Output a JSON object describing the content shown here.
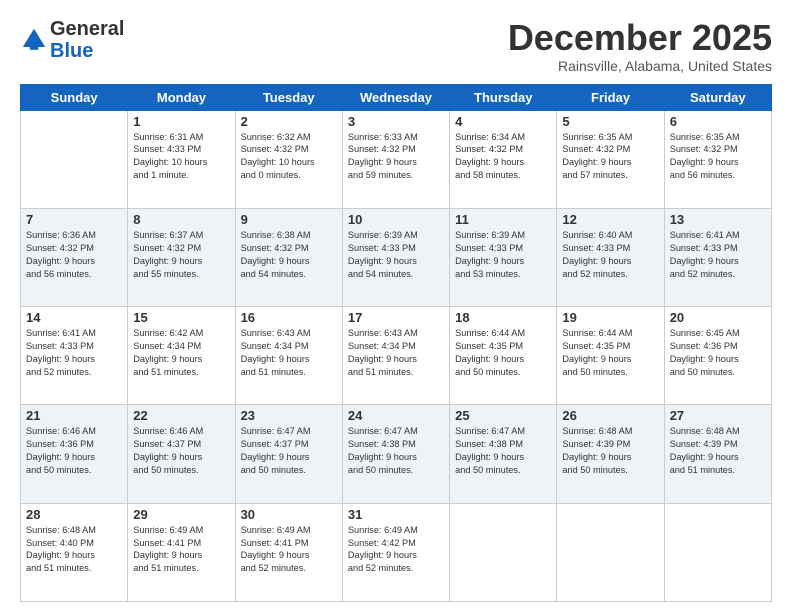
{
  "header": {
    "logo_general": "General",
    "logo_blue": "Blue",
    "month_title": "December 2025",
    "location": "Rainsville, Alabama, United States"
  },
  "days_of_week": [
    "Sunday",
    "Monday",
    "Tuesday",
    "Wednesday",
    "Thursday",
    "Friday",
    "Saturday"
  ],
  "weeks": [
    [
      {
        "day": "",
        "info": ""
      },
      {
        "day": "1",
        "info": "Sunrise: 6:31 AM\nSunset: 4:33 PM\nDaylight: 10 hours\nand 1 minute."
      },
      {
        "day": "2",
        "info": "Sunrise: 6:32 AM\nSunset: 4:32 PM\nDaylight: 10 hours\nand 0 minutes."
      },
      {
        "day": "3",
        "info": "Sunrise: 6:33 AM\nSunset: 4:32 PM\nDaylight: 9 hours\nand 59 minutes."
      },
      {
        "day": "4",
        "info": "Sunrise: 6:34 AM\nSunset: 4:32 PM\nDaylight: 9 hours\nand 58 minutes."
      },
      {
        "day": "5",
        "info": "Sunrise: 6:35 AM\nSunset: 4:32 PM\nDaylight: 9 hours\nand 57 minutes."
      },
      {
        "day": "6",
        "info": "Sunrise: 6:35 AM\nSunset: 4:32 PM\nDaylight: 9 hours\nand 56 minutes."
      }
    ],
    [
      {
        "day": "7",
        "info": "Sunrise: 6:36 AM\nSunset: 4:32 PM\nDaylight: 9 hours\nand 56 minutes."
      },
      {
        "day": "8",
        "info": "Sunrise: 6:37 AM\nSunset: 4:32 PM\nDaylight: 9 hours\nand 55 minutes."
      },
      {
        "day": "9",
        "info": "Sunrise: 6:38 AM\nSunset: 4:32 PM\nDaylight: 9 hours\nand 54 minutes."
      },
      {
        "day": "10",
        "info": "Sunrise: 6:39 AM\nSunset: 4:33 PM\nDaylight: 9 hours\nand 54 minutes."
      },
      {
        "day": "11",
        "info": "Sunrise: 6:39 AM\nSunset: 4:33 PM\nDaylight: 9 hours\nand 53 minutes."
      },
      {
        "day": "12",
        "info": "Sunrise: 6:40 AM\nSunset: 4:33 PM\nDaylight: 9 hours\nand 52 minutes."
      },
      {
        "day": "13",
        "info": "Sunrise: 6:41 AM\nSunset: 4:33 PM\nDaylight: 9 hours\nand 52 minutes."
      }
    ],
    [
      {
        "day": "14",
        "info": "Sunrise: 6:41 AM\nSunset: 4:33 PM\nDaylight: 9 hours\nand 52 minutes."
      },
      {
        "day": "15",
        "info": "Sunrise: 6:42 AM\nSunset: 4:34 PM\nDaylight: 9 hours\nand 51 minutes."
      },
      {
        "day": "16",
        "info": "Sunrise: 6:43 AM\nSunset: 4:34 PM\nDaylight: 9 hours\nand 51 minutes."
      },
      {
        "day": "17",
        "info": "Sunrise: 6:43 AM\nSunset: 4:34 PM\nDaylight: 9 hours\nand 51 minutes."
      },
      {
        "day": "18",
        "info": "Sunrise: 6:44 AM\nSunset: 4:35 PM\nDaylight: 9 hours\nand 50 minutes."
      },
      {
        "day": "19",
        "info": "Sunrise: 6:44 AM\nSunset: 4:35 PM\nDaylight: 9 hours\nand 50 minutes."
      },
      {
        "day": "20",
        "info": "Sunrise: 6:45 AM\nSunset: 4:36 PM\nDaylight: 9 hours\nand 50 minutes."
      }
    ],
    [
      {
        "day": "21",
        "info": "Sunrise: 6:46 AM\nSunset: 4:36 PM\nDaylight: 9 hours\nand 50 minutes."
      },
      {
        "day": "22",
        "info": "Sunrise: 6:46 AM\nSunset: 4:37 PM\nDaylight: 9 hours\nand 50 minutes."
      },
      {
        "day": "23",
        "info": "Sunrise: 6:47 AM\nSunset: 4:37 PM\nDaylight: 9 hours\nand 50 minutes."
      },
      {
        "day": "24",
        "info": "Sunrise: 6:47 AM\nSunset: 4:38 PM\nDaylight: 9 hours\nand 50 minutes."
      },
      {
        "day": "25",
        "info": "Sunrise: 6:47 AM\nSunset: 4:38 PM\nDaylight: 9 hours\nand 50 minutes."
      },
      {
        "day": "26",
        "info": "Sunrise: 6:48 AM\nSunset: 4:39 PM\nDaylight: 9 hours\nand 50 minutes."
      },
      {
        "day": "27",
        "info": "Sunrise: 6:48 AM\nSunset: 4:39 PM\nDaylight: 9 hours\nand 51 minutes."
      }
    ],
    [
      {
        "day": "28",
        "info": "Sunrise: 6:48 AM\nSunset: 4:40 PM\nDaylight: 9 hours\nand 51 minutes."
      },
      {
        "day": "29",
        "info": "Sunrise: 6:49 AM\nSunset: 4:41 PM\nDaylight: 9 hours\nand 51 minutes."
      },
      {
        "day": "30",
        "info": "Sunrise: 6:49 AM\nSunset: 4:41 PM\nDaylight: 9 hours\nand 52 minutes."
      },
      {
        "day": "31",
        "info": "Sunrise: 6:49 AM\nSunset: 4:42 PM\nDaylight: 9 hours\nand 52 minutes."
      },
      {
        "day": "",
        "info": ""
      },
      {
        "day": "",
        "info": ""
      },
      {
        "day": "",
        "info": ""
      }
    ]
  ]
}
